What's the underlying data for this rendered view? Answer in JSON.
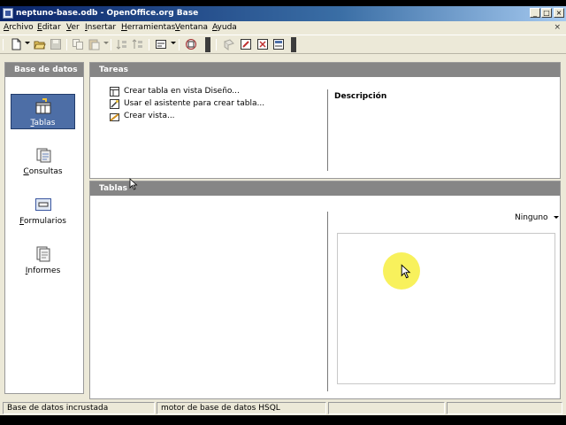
{
  "window": {
    "title": "neptuno-base.odb - OpenOffice.org Base",
    "buttons": {
      "minimize": "_",
      "maximize": "□",
      "close": "×"
    }
  },
  "menubar": {
    "items": [
      "Archivo",
      "Editar",
      "Ver",
      "Insertar",
      "Herramientas",
      "Ventana",
      "Ayuda"
    ],
    "close_document": "×"
  },
  "toolbar": {
    "icons": [
      "new-document-icon",
      "open-folder-icon",
      "save-icon",
      "copy-icon",
      "paste-icon",
      "sort-ascending-icon",
      "sort-descending-icon",
      "report-icon",
      "form-icon",
      "edit-icon",
      "delete-icon",
      "rename-icon",
      "properties-icon"
    ]
  },
  "left_panel": {
    "header": "Base de datos",
    "items": [
      {
        "label": "Tablas",
        "icon": "tables-icon",
        "selected": true
      },
      {
        "label": "Consultas",
        "icon": "queries-icon",
        "selected": false
      },
      {
        "label": "Formularios",
        "icon": "forms-icon",
        "selected": false
      },
      {
        "label": "Informes",
        "icon": "reports-icon",
        "selected": false
      }
    ]
  },
  "tasks_panel": {
    "header": "Tareas",
    "tasks": [
      {
        "label": "Crear tabla en vista Diseño...",
        "icon": "table-design-icon"
      },
      {
        "label": "Usar el asistente para crear tabla...",
        "icon": "table-wizard-icon"
      },
      {
        "label": "Crear vista...",
        "icon": "create-view-icon"
      }
    ],
    "description_label": "Descripción"
  },
  "tables_panel": {
    "header": "Tablas",
    "preview_mode": "Ninguno"
  },
  "statusbar": {
    "cells": [
      "Base de datos incrustada",
      "motor de base de datos HSQL",
      "",
      ""
    ]
  },
  "colors": {
    "titlebar_start": "#0a246a",
    "panel_header": "#868686",
    "selected_item": "#4d6ea6",
    "cursor_highlight": "#f7ef4a"
  }
}
